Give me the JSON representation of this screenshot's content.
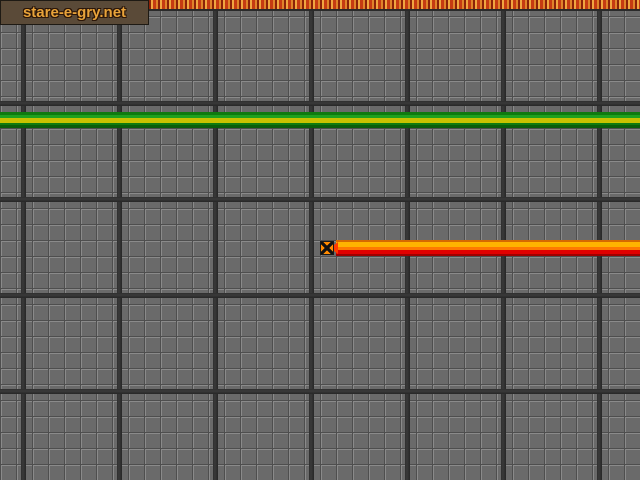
{
  "watermark": {
    "text": "stare-e-gry.net"
  },
  "colors": {
    "floor": "#6a6a6a",
    "grid_line": "#2e2e2e",
    "green_trail": "#1fa11f",
    "red_trail": "#ff7a00",
    "player": "#ff8a00"
  },
  "icons": {
    "player": "light-cycle-icon"
  }
}
